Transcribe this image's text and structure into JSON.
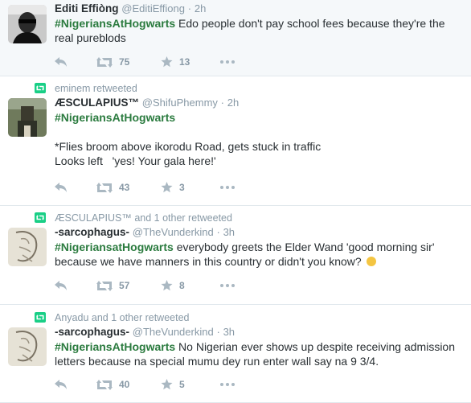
{
  "colors": {
    "hashtag": "#2b7b3f",
    "retweet_green": "#19cf86",
    "muted": "#8899a6",
    "divider": "#e1e8ed"
  },
  "tweets": [
    {
      "context": "",
      "fullname": "Editi Effiòng",
      "username": "@EditiEffiong",
      "separator": "·",
      "time": "2h",
      "hashtag": "#NigeriansAtHogwarts",
      "text": " Edo people don't pay school fees because they're the real pureblods",
      "retweets": "75",
      "favorites": "13",
      "icons": [
        "reply-icon",
        "retweet-icon",
        "star-icon",
        "more-icon"
      ]
    },
    {
      "context": "eminem retweeted",
      "fullname": "ÆSCULAPIUS™",
      "username": "@ShifuPhemmy",
      "separator": "·",
      "time": "2h",
      "hashtag": "#NigeriansAtHogwarts",
      "line1": "*Flies broom above ikorodu Road, gets stuck in traffic",
      "line2": "Looks left   'yes! Your gala here!'",
      "retweets": "43",
      "favorites": "3"
    },
    {
      "context": "ÆSCULAPIUS™ and 1 other retweeted",
      "fullname": "-sarcophagus-",
      "username": "@TheVunderkind",
      "separator": "·",
      "time": "3h",
      "hashtag": "#NigeriansatHogwarts",
      "text": " everybody greets the Elder Wand 'good morning sir' because we have manners in this country or didn't you know?",
      "retweets": "57",
      "favorites": "8"
    },
    {
      "context": "Anyadu and 1 other retweeted",
      "fullname": "-sarcophagus-",
      "username": "@TheVunderkind",
      "separator": "·",
      "time": "3h",
      "hashtag": "#NigeriansAtHogwarts",
      "text": " No Nigerian ever shows up despite receiving admission letters because na special mumu dey run enter wall say na 9 3/4.",
      "retweets": "40",
      "favorites": "5"
    }
  ]
}
